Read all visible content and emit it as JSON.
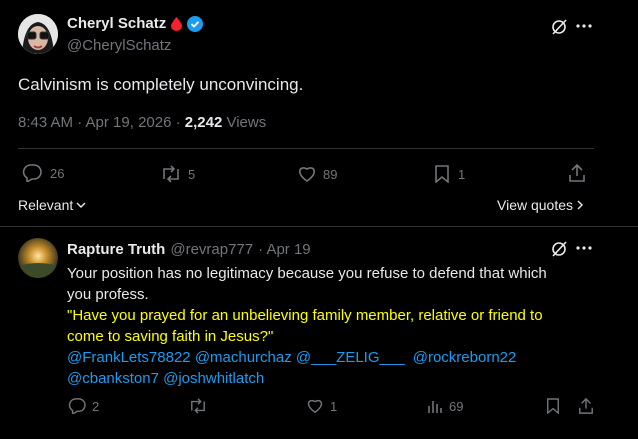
{
  "post": {
    "author_name": "Cheryl Schatz",
    "handle": "@CherylSchatz",
    "text": "Calvinism is completely unconvincing.",
    "time": "8:43 AM · Apr 19, 2026 · ",
    "views_count": "2,242",
    "views_label": " Views",
    "replies": "26",
    "reposts": "5",
    "likes": "89",
    "bookmarks": "1"
  },
  "sort": {
    "label": "Relevant",
    "view_quotes": "View quotes"
  },
  "reply": {
    "author_name": "Rapture Truth",
    "handle": "@revrap777",
    "time": "· Apr 19",
    "line1": "Your position has no legitimacy because you refuse to defend that which",
    "line2": "you profess.",
    "quote1": "\"Have you prayed for an unbelieving family member, relative or friend to",
    "quote2": "come to saving faith in Jesus?\"",
    "mentions1": [
      "@FrankLets78822",
      "@machurchaz",
      "@___ZELIG___",
      "@rockreborn22"
    ],
    "mentions2": [
      "@cbankston7",
      "@joshwhitlatch"
    ],
    "replies": "2",
    "likes": "1",
    "views": "69"
  },
  "colors": {
    "accent": "#1d9bf0",
    "quote": "#ffff00",
    "muted": "#71767b",
    "verified": "#1d9bf0",
    "drop": "#f4212e"
  }
}
